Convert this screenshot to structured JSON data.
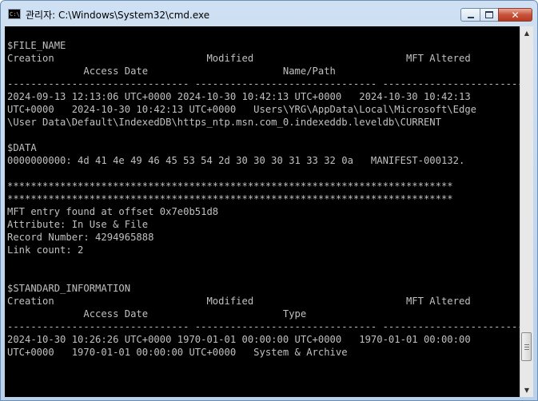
{
  "window": {
    "title": "관리자: C:\\Windows\\System32\\cmd.exe",
    "icon_text": "C:\\",
    "close_glyph": "✕"
  },
  "console": {
    "lines": [
      "$FILE_NAME",
      "Creation                          Modified                          MFT Altered",
      "             Access Date                       Name/Path",
      "------------------------------- ------------------------------- ------------------------------- --------------------------------------------",
      "2024-09-13 12:13:06 UTC+0000 2024-10-30 10:42:13 UTC+0000   2024-10-30 10:42:13",
      "UTC+0000   2024-10-30 10:42:13 UTC+0000   Users\\YRG\\AppData\\Local\\Microsoft\\Edge",
      "\\User Data\\Default\\IndexedDB\\https_ntp.msn.com_0.indexeddb.leveldb\\CURRENT",
      "",
      "$DATA",
      "0000000000: 4d 41 4e 49 46 45 53 54 2d 30 30 30 31 33 32 0a   MANIFEST-000132.",
      "",
      "****************************************************************************",
      "****************************************************************************",
      "MFT entry found at offset 0x7e0b51d8",
      "Attribute: In Use & File",
      "Record Number: 4294965888",
      "Link count: 2",
      "",
      "",
      "$STANDARD_INFORMATION",
      "Creation                          Modified                          MFT Altered",
      "             Access Date                       Type",
      "------------------------------- ------------------------------- ------------------------------- ---------------------",
      "2024-10-30 10:26:26 UTC+0000 1970-01-01 00:00:00 UTC+0000   1970-01-01 00:00:00",
      "UTC+0000   1970-01-01 00:00:00 UTC+0000   System & Archive"
    ]
  },
  "scrollbar": {
    "up_glyph": "▲",
    "down_glyph": "▼",
    "position_fraction": 0.93
  }
}
